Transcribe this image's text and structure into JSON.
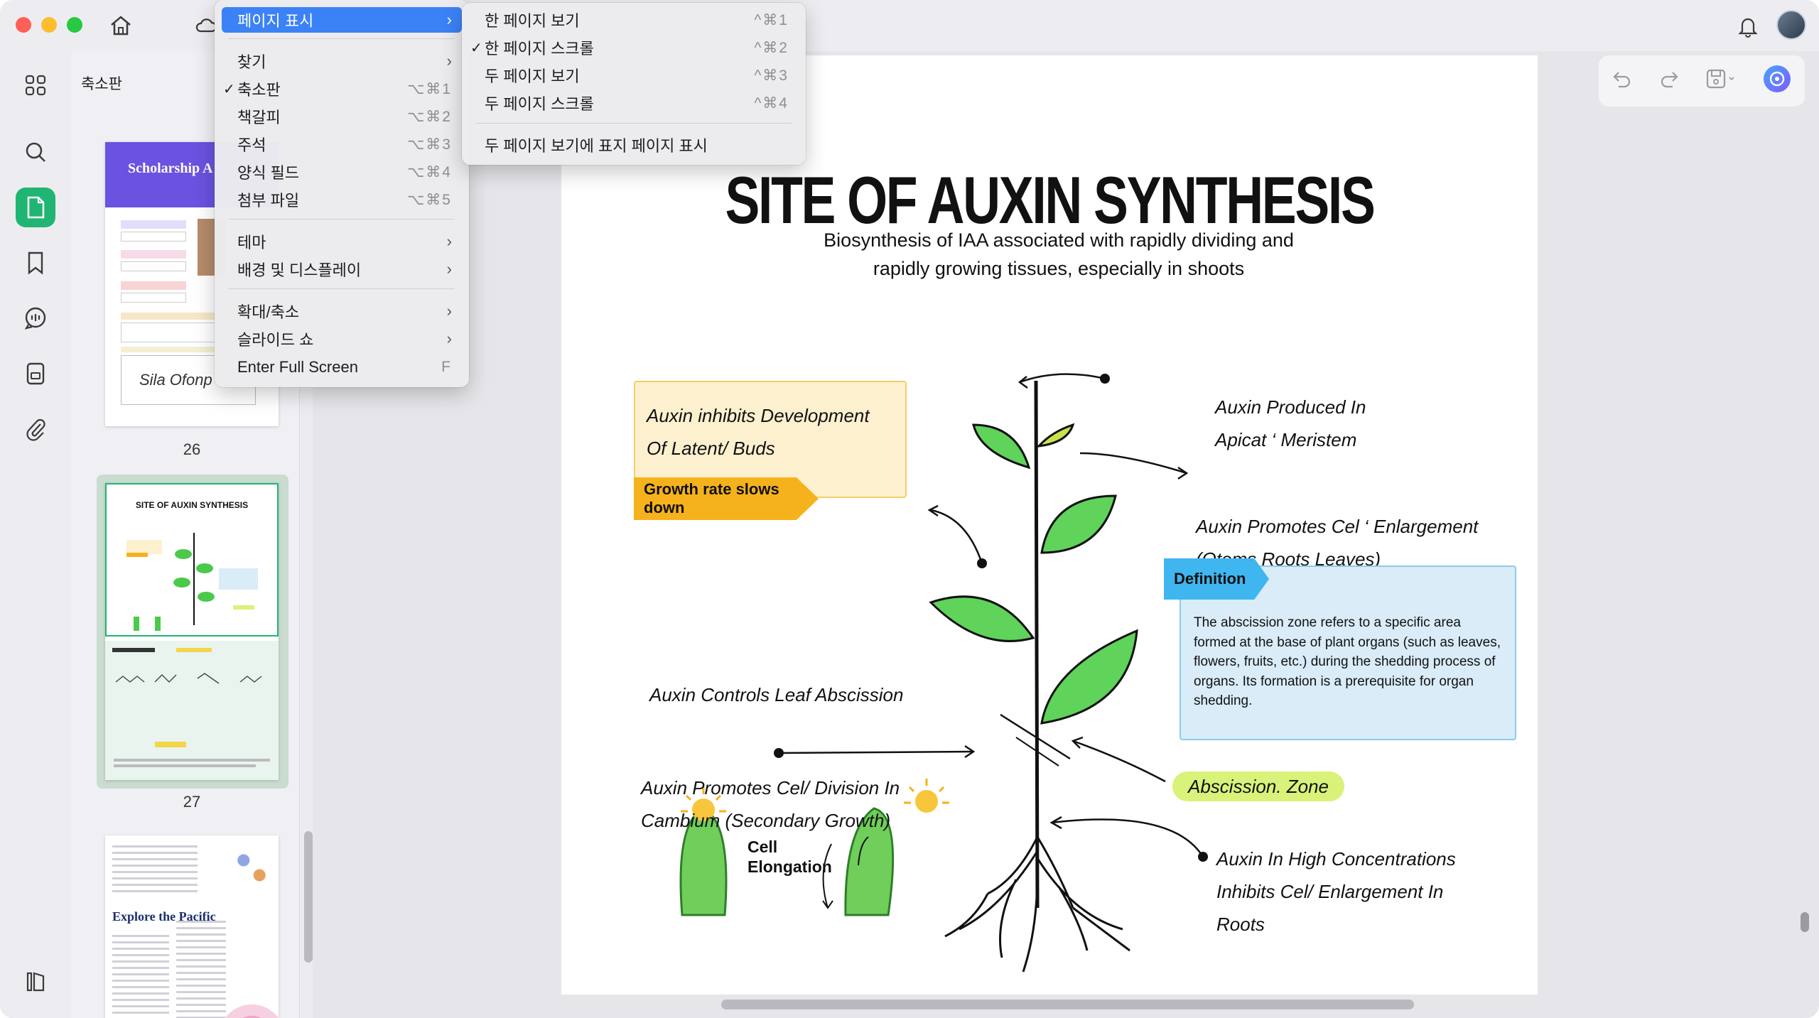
{
  "sidebar": {
    "panel_title": "축소판",
    "thumbnails": [
      {
        "page": "26",
        "title": "Scholarship Application Fo",
        "signature": "Sila Ofonp"
      },
      {
        "page": "27",
        "title": "SITE OF AUXIN SYNTHESIS"
      },
      {
        "page": "",
        "title": "Explore the Pacific"
      }
    ]
  },
  "toolbar": {
    "close_label": "닫기"
  },
  "view_menu": {
    "items": [
      {
        "label": "페이지 표시",
        "shortcut": "",
        "submenu": true,
        "checked": false,
        "highlighted": true
      },
      {
        "label": "찾기",
        "shortcut": "",
        "submenu": true,
        "checked": false
      },
      {
        "label": "축소판",
        "shortcut": "⌥⌘1",
        "submenu": false,
        "checked": true
      },
      {
        "label": "책갈피",
        "shortcut": "⌥⌘2",
        "submenu": false,
        "checked": false
      },
      {
        "label": "주석",
        "shortcut": "⌥⌘3",
        "submenu": false,
        "checked": false
      },
      {
        "label": "양식 필드",
        "shortcut": "⌥⌘4",
        "submenu": false,
        "checked": false
      },
      {
        "label": "첨부 파일",
        "shortcut": "⌥⌘5",
        "submenu": false,
        "checked": false
      },
      {
        "label": "테마",
        "shortcut": "",
        "submenu": true,
        "checked": false
      },
      {
        "label": "배경 및 디스플레이",
        "shortcut": "",
        "submenu": true,
        "checked": false
      },
      {
        "label": "확대/축소",
        "shortcut": "",
        "submenu": true,
        "checked": false
      },
      {
        "label": "슬라이드 쇼",
        "shortcut": "",
        "submenu": true,
        "checked": false
      },
      {
        "label": "Enter Full Screen",
        "shortcut": "F",
        "submenu": false,
        "checked": false
      }
    ]
  },
  "page_display_submenu": {
    "items": [
      {
        "label": "한 페이지 보기",
        "shortcut": "^⌘1",
        "checked": false
      },
      {
        "label": "한 페이지 스크롤",
        "shortcut": "^⌘2",
        "checked": true
      },
      {
        "label": "두 페이지 보기",
        "shortcut": "^⌘3",
        "checked": false
      },
      {
        "label": "두 페이지 스크롤",
        "shortcut": "^⌘4",
        "checked": false
      },
      {
        "label": "두 페이지 보기에 표지 페이지 표시",
        "shortcut": "",
        "checked": false
      }
    ]
  },
  "document": {
    "title": "SITE OF AUXIN SYNTHESIS",
    "subtitle_line1": "Biosynthesis of IAA associated with rapidly dividing and",
    "subtitle_line2": "rapidly growing tissues, especially in shoots",
    "box1_line1": "Auxin inhibits Development",
    "box1_line2": "Of Latent/ Buds",
    "growth_tag": "Growth rate slows down",
    "label_produced_1": "Auxin Produced In",
    "label_produced_2": "Apicat ‘ Meristem",
    "label_enlarge_1": "Auxin Promotes Cel ‘ Enlargement",
    "label_enlarge_2": "(Qtems Roots Leaves)",
    "definition_tag": "Definition",
    "definition_text": "The abscission zone refers to a specific area formed at the base of plant organs (such as leaves, flowers, fruits, etc.) during the shedding process of organs. Its formation is a prerequisite for organ shedding.",
    "label_leaf_abscission": "Auxin Controls Leaf Abscission",
    "label_division_1": "Auxin Promotes Cel/ Division In",
    "label_division_2": "Cambium (Secondary Growth)",
    "abscission_zone": "Abscission. Zone",
    "cell_elongation_1": "Cell",
    "cell_elongation_2": "Elongation",
    "label_high_1": "Auxin In High Concentrations",
    "label_high_2": "Inhibits Cel/ Enlargement In",
    "label_high_3": "Roots"
  },
  "colors": {
    "accent_green": "#21b573",
    "menu_highlight": "#3b82f7",
    "growth_tag": "#f6b21c",
    "definition_tag": "#3fb6ef",
    "abscission_zone": "#d9f27a"
  }
}
